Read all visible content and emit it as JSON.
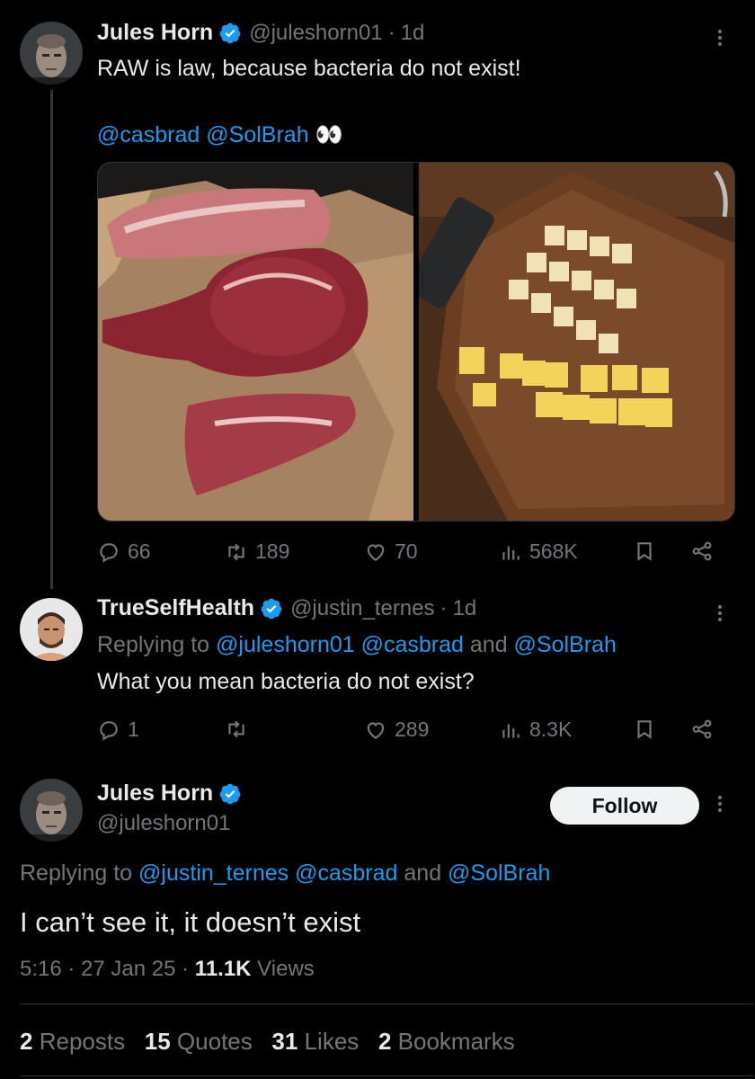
{
  "tweet1": {
    "name": "Jules Horn",
    "handle": "@juleshorn01",
    "time": "1d",
    "text": "RAW is law, because bacteria do not exist!",
    "mention1": "@casbrad",
    "mention2": "@SolBrah",
    "emoji": "👀",
    "replies": "66",
    "reposts": "189",
    "likes": "70",
    "views": "568K"
  },
  "tweet2": {
    "name": "TrueSelfHealth",
    "handle": "@justin_ternes",
    "time": "1d",
    "replying_prefix": "Replying to ",
    "replying_to": "@juleshorn01 @casbrad",
    "replying_and": " and ",
    "replying_last": "@SolBrah",
    "text": "What you mean bacteria do not exist?",
    "replies": "1",
    "reposts": "",
    "likes": "289",
    "views": "8.3K"
  },
  "tweet3": {
    "name": "Jules Horn",
    "handle": "@juleshorn01",
    "follow_label": "Follow",
    "replying_prefix": "Replying to ",
    "replying_to": "@justin_ternes @casbrad",
    "replying_and": " and ",
    "replying_last": "@SolBrah",
    "text": "I can’t see it, it doesn’t exist",
    "timestamp": "5:16 · 27 Jan 25 · ",
    "views_count": "11.1K",
    "views_label": " Views",
    "stats": [
      {
        "count": "2",
        "label": "Reposts"
      },
      {
        "count": "15",
        "label": "Quotes"
      },
      {
        "count": "31",
        "label": "Likes"
      },
      {
        "count": "2",
        "label": "Bookmarks"
      }
    ]
  },
  "colors": {
    "background": "#000000",
    "text": "#e7e9ea",
    "muted": "#71767b",
    "link": "#1d9bf0",
    "verified": "#1d9bf0",
    "follow_bg": "#eff3f4"
  },
  "separator": "·"
}
